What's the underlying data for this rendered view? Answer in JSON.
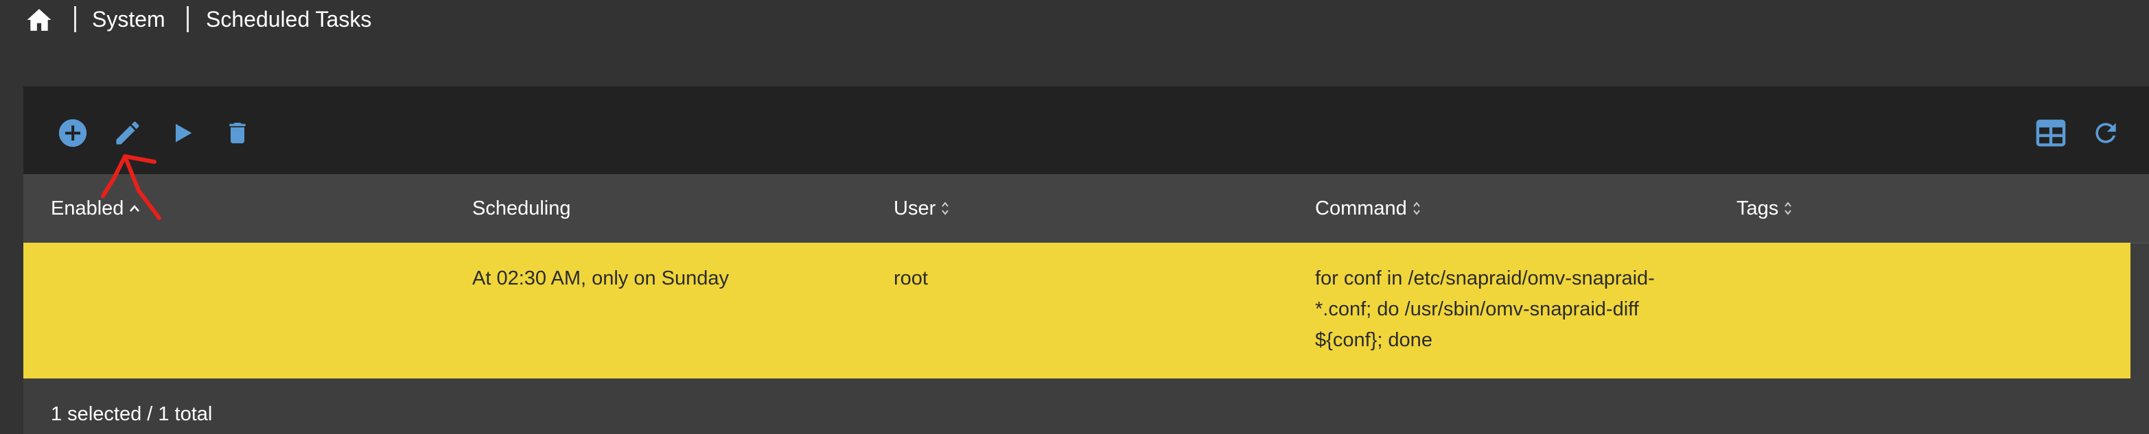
{
  "breadcrumb": {
    "items": [
      "System",
      "Scheduled Tasks"
    ]
  },
  "toolbar": {
    "buttons": [
      {
        "name": "add",
        "icon": "plus-circle-icon"
      },
      {
        "name": "edit",
        "icon": "pencil-icon"
      },
      {
        "name": "run",
        "icon": "play-icon"
      },
      {
        "name": "delete",
        "icon": "trash-icon"
      }
    ],
    "right_buttons": [
      {
        "name": "columns",
        "icon": "table-columns-icon"
      },
      {
        "name": "reload",
        "icon": "refresh-icon"
      }
    ]
  },
  "table": {
    "columns": [
      "Enabled",
      "Scheduling",
      "User",
      "Command",
      "Tags"
    ],
    "rows": [
      {
        "enabled": "",
        "scheduling": "At 02:30 AM, only on Sunday",
        "user": "root",
        "command_lines": [
          "for conf in /etc/snapraid/omv-snapraid-",
          "*.conf; do /usr/sbin/omv-snapraid-diff",
          "${conf}; done"
        ],
        "tags": "",
        "selected": true
      }
    ]
  },
  "footer": {
    "status": "1 selected / 1 total"
  },
  "colors": {
    "accent": "#5b9bd5",
    "selected_row": "#f0d63a",
    "annotation": "#e8201a"
  }
}
